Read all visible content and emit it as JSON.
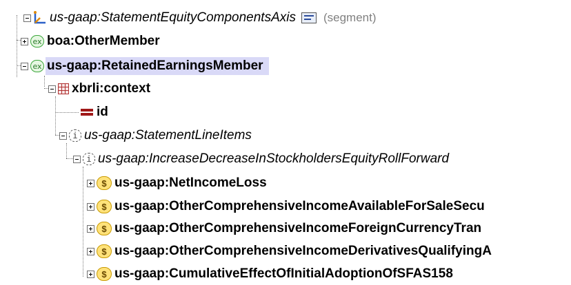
{
  "tree": {
    "axis": {
      "label": "us-gaap:StatementEquityComponentsAxis",
      "suffix": "(segment)"
    },
    "member_other": {
      "prefix": "ex",
      "label": "boa:OtherMember"
    },
    "member_retained": {
      "prefix": "ex",
      "label": "us-gaap:RetainedEarningsMember"
    },
    "context": {
      "label": "xbrli:context"
    },
    "id_attr": {
      "label": "id"
    },
    "line_items": {
      "prefix": "i",
      "label": "us-gaap:StatementLineItems"
    },
    "roll_forward": {
      "prefix": "i",
      "label": "us-gaap:IncreaseDecreaseInStockholdersEquityRollForward"
    },
    "items": [
      {
        "prefix": "$",
        "label": "us-gaap:NetIncomeLoss"
      },
      {
        "prefix": "$",
        "label": "us-gaap:OtherComprehensiveIncomeAvailableForSaleSecu"
      },
      {
        "prefix": "$",
        "label": "us-gaap:OtherComprehensiveIncomeForeignCurrencyTran"
      },
      {
        "prefix": "$",
        "label": "us-gaap:OtherComprehensiveIncomeDerivativesQualifyingA"
      },
      {
        "prefix": "$",
        "label": "us-gaap:CumulativeEffectOfInitialAdoptionOfSFAS158"
      }
    ]
  }
}
